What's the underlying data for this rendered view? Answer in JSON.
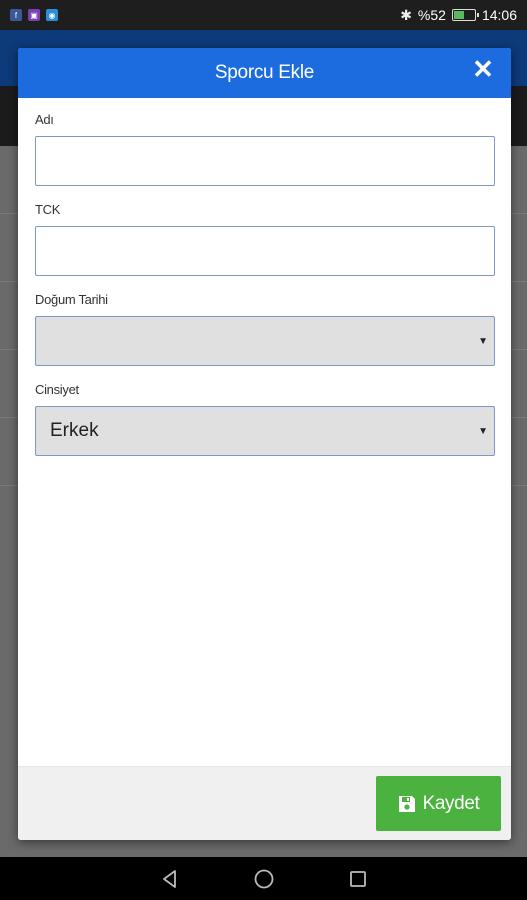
{
  "status_bar": {
    "battery_text": "%52",
    "battery_level": 0.52,
    "time": "14:06",
    "app_icons": [
      {
        "name": "facebook-app-icon",
        "color": "#3b5998"
      },
      {
        "name": "calendar-app-icon",
        "color": "#7b3fb3"
      },
      {
        "name": "browser-app-icon",
        "color": "#2a8fd6"
      }
    ]
  },
  "modal": {
    "title": "Sporcu Ekle",
    "close_icon": "close-icon",
    "fields": {
      "name_label": "Adı",
      "name_value": "",
      "tck_label": "TCK",
      "tck_value": "",
      "birth_date_label": "Doğum Tarihi",
      "birth_date_value": "",
      "gender_label": "Cinsiyet",
      "gender_value": "Erkek"
    },
    "save_label": "Kaydet",
    "save_icon": "floppy-disk-icon"
  },
  "colors": {
    "header_blue": "#1c6ce0",
    "save_green": "#4cb23f"
  }
}
